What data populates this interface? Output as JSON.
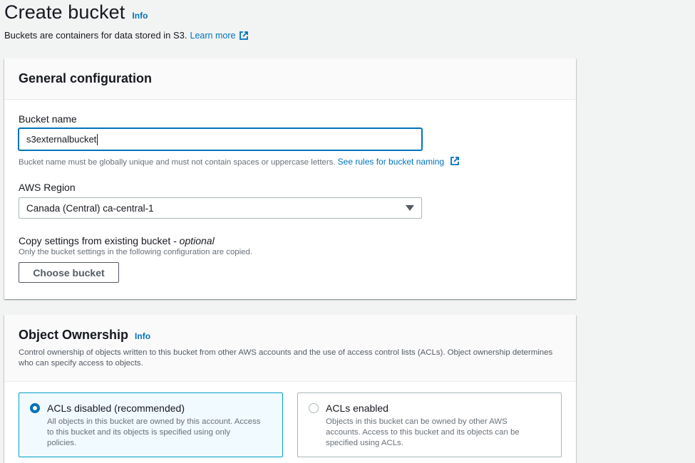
{
  "header": {
    "title": "Create bucket",
    "info": "Info",
    "description": "Buckets are containers for data stored in S3.",
    "learn_more": "Learn more"
  },
  "general": {
    "title": "General configuration",
    "bucket_name_label": "Bucket name",
    "bucket_name_value": "s3externalbucket",
    "bucket_name_hint": "Bucket name must be globally unique and must not contain spaces or uppercase letters.",
    "naming_rules_link": "See rules for bucket naming",
    "region_label": "AWS Region",
    "region_value": "Canada (Central) ca-central-1",
    "copy_label": "Copy settings from existing bucket - ",
    "copy_optional": "optional",
    "copy_hint": "Only the bucket settings in the following configuration are copied.",
    "choose_button": "Choose bucket"
  },
  "ownership": {
    "title": "Object Ownership",
    "info": "Info",
    "description": "Control ownership of objects written to this bucket from other AWS accounts and the use of access control lists (ACLs). Object ownership determines who can specify access to objects.",
    "options": [
      {
        "label": "ACLs disabled (recommended)",
        "description": "All objects in this bucket are owned by this account. Access to this bucket and its objects is specified using only policies.",
        "selected": true
      },
      {
        "label": "ACLs enabled",
        "description": "Objects in this bucket can be owned by other AWS accounts. Access to this bucket and its objects can be specified using ACLs.",
        "selected": false
      }
    ]
  },
  "colors": {
    "link": "#0073bb",
    "focus_border": "#0073bb",
    "selected_tile_bg": "#f1faff",
    "selected_tile_border": "#00a1c9",
    "page_bg": "#f2f3f3"
  },
  "icons": {
    "external_link": "external-link-icon",
    "dropdown": "caret-down-icon",
    "radio_on": "radio-selected-icon",
    "radio_off": "radio-unselected-icon"
  }
}
